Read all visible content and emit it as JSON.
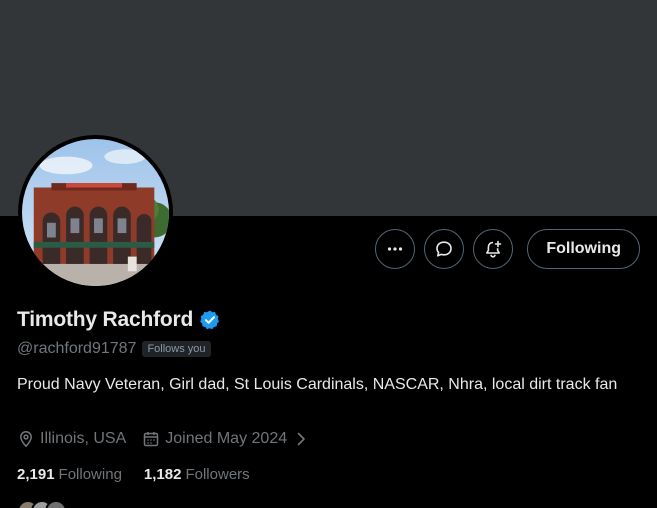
{
  "profile": {
    "display_name": "Timothy Rachford",
    "handle": "@rachford91787",
    "follows_you_badge": "Follows you",
    "bio": "Proud Navy Veteran, Girl dad, St Louis Cardinals, NASCAR, Nhra, local dirt track fan",
    "location": "Illinois, USA",
    "joined": "Joined May 2024",
    "verified": true
  },
  "stats": {
    "following_count": "2,191",
    "following_label": "Following",
    "followers_count": "1,182",
    "followers_label": "Followers"
  },
  "actions": {
    "more_icon": "more-horizontal-icon",
    "message_icon": "message-bubble-icon",
    "notify_icon": "bell-plus-icon",
    "follow_button_label": "Following"
  },
  "colors": {
    "background": "#000000",
    "banner": "#333639",
    "text_primary": "#e7e9ea",
    "text_secondary": "#71767b",
    "verified_blue": "#1d9bf0",
    "border": "#536471"
  }
}
